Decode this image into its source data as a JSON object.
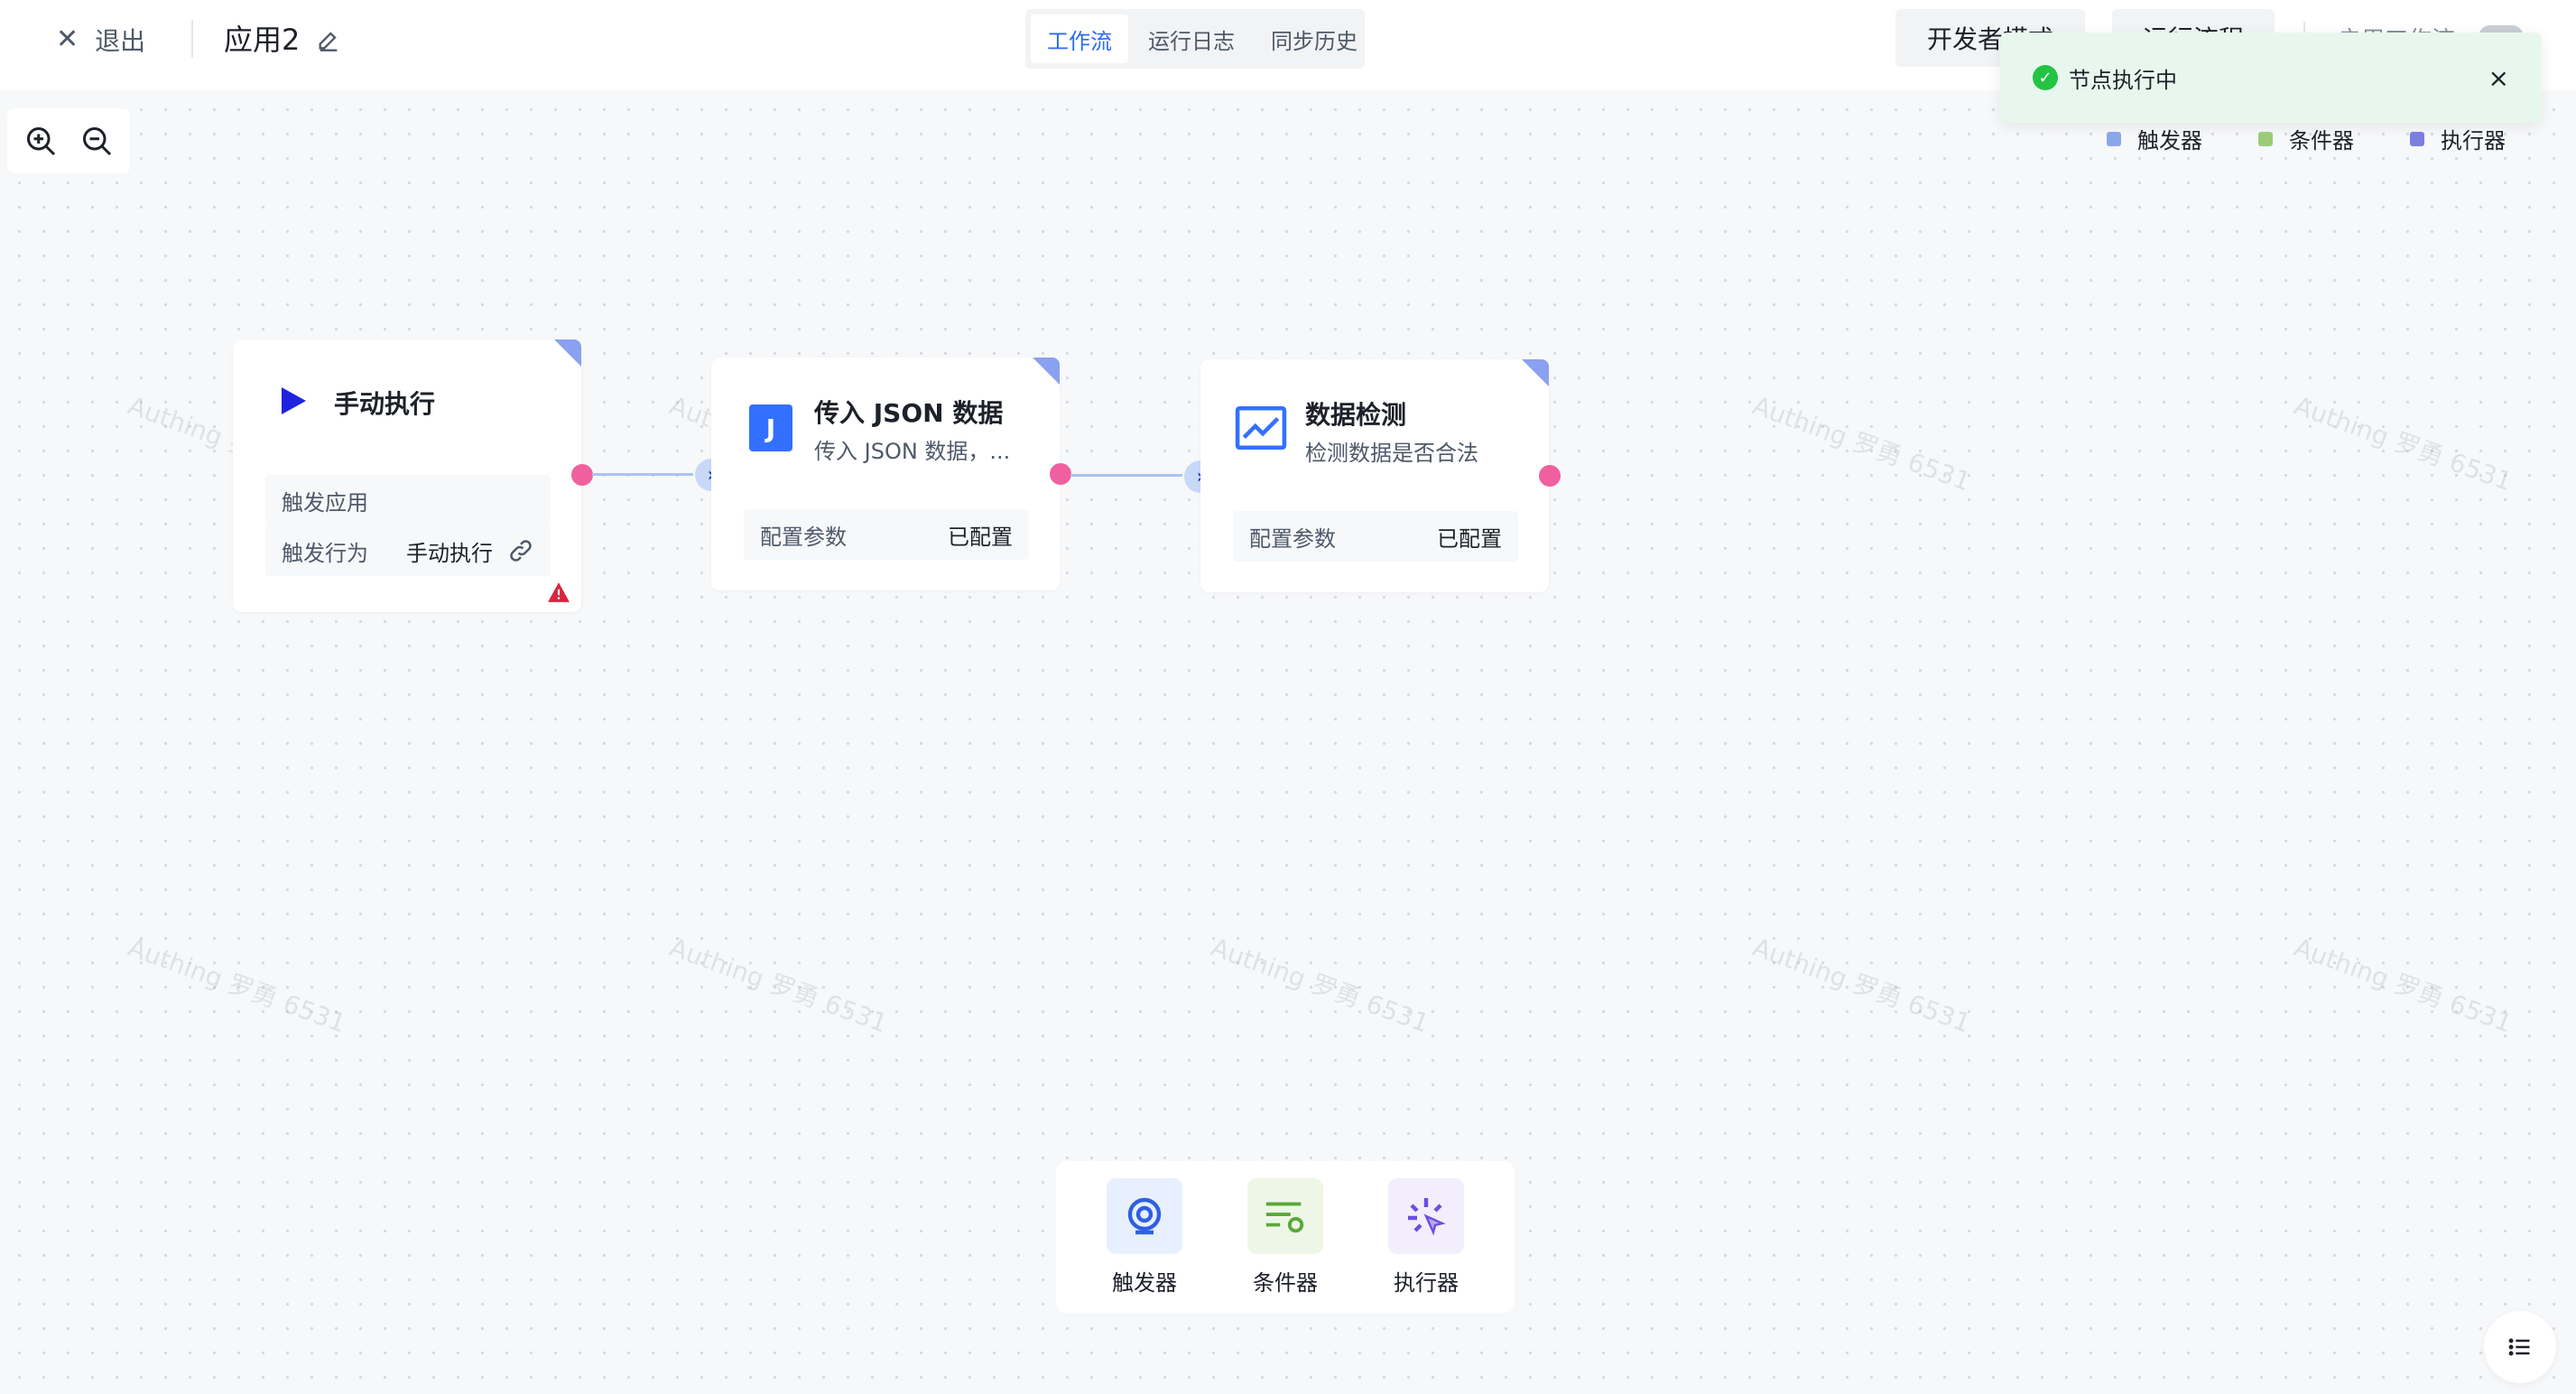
{
  "header": {
    "exit_label": "退出",
    "app_title": "应用2",
    "tabs": [
      {
        "label": "工作流",
        "active": true
      },
      {
        "label": "运行日志",
        "active": false
      },
      {
        "label": "同步历史",
        "active": false
      }
    ],
    "dev_mode_label": "开发者模式",
    "run_label": "运行流程",
    "enable_label": "启用工作流"
  },
  "toast": {
    "text": "节点执行中",
    "status_color": "#23c343"
  },
  "legend": [
    {
      "label": "触发器",
      "color": "#8aa8e8"
    },
    {
      "label": "条件器",
      "color": "#9ccc7a"
    },
    {
      "label": "执行器",
      "color": "#7b7fe0"
    }
  ],
  "watermark_text": "Authing 罗勇 6531",
  "nodes": {
    "trigger": {
      "title": "手动执行",
      "rows": [
        {
          "label": "触发应用",
          "value": ""
        },
        {
          "label": "触发行为",
          "value": "手动执行"
        }
      ]
    },
    "json": {
      "title": "传入 JSON 数据",
      "subtitle": "传入 JSON 数据，...",
      "icon_letter": "J",
      "row": {
        "label": "配置参数",
        "value": "已配置"
      }
    },
    "check": {
      "title": "数据检测",
      "subtitle": "检测数据是否合法",
      "row": {
        "label": "配置参数",
        "value": "已配置"
      }
    }
  },
  "dock": [
    {
      "label": "触发器",
      "icon": "trigger-icon"
    },
    {
      "label": "条件器",
      "icon": "condition-icon"
    },
    {
      "label": "执行器",
      "icon": "executor-icon"
    }
  ]
}
